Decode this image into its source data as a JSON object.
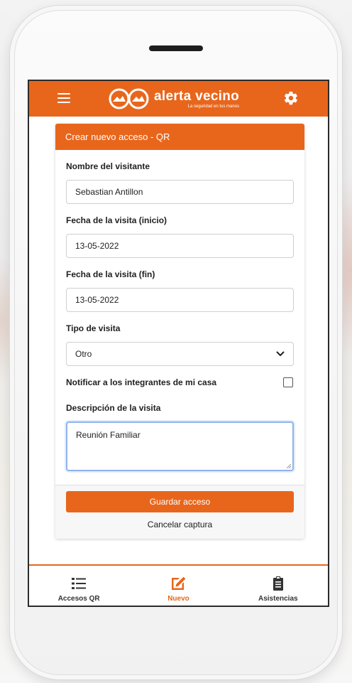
{
  "header": {
    "brand_name": "alerta vecino",
    "brand_tagline": "La seguridad en tus manos",
    "menu_icon": "hamburger-menu-icon",
    "settings_icon": "gear-icon",
    "accent_color": "#e8661c"
  },
  "card": {
    "title": "Crear nuevo acceso - QR"
  },
  "form": {
    "visitor_name_label": "Nombre del visitante",
    "visitor_name_value": "Sebastian Antillon",
    "start_date_label": "Fecha de la visita (inicio)",
    "start_date_value": "13-05-2022",
    "end_date_label": "Fecha de la visita (fin)",
    "end_date_value": "13-05-2022",
    "visit_type_label": "Tipo de visita",
    "visit_type_value": "Otro",
    "notify_label": "Notificar a los integrantes de mi casa",
    "notify_checked": false,
    "description_label": "Descripción de la visita",
    "description_value": "Reunión Familiar"
  },
  "actions": {
    "save_label": "Guardar acceso",
    "cancel_label": "Cancelar captura"
  },
  "bottom_nav": {
    "items": [
      {
        "label": "Accesos QR",
        "icon": "list-icon",
        "active": false
      },
      {
        "label": "Nuevo",
        "icon": "edit-icon",
        "active": true
      },
      {
        "label": "Asistencias",
        "icon": "clipboard-icon",
        "active": false
      }
    ]
  }
}
